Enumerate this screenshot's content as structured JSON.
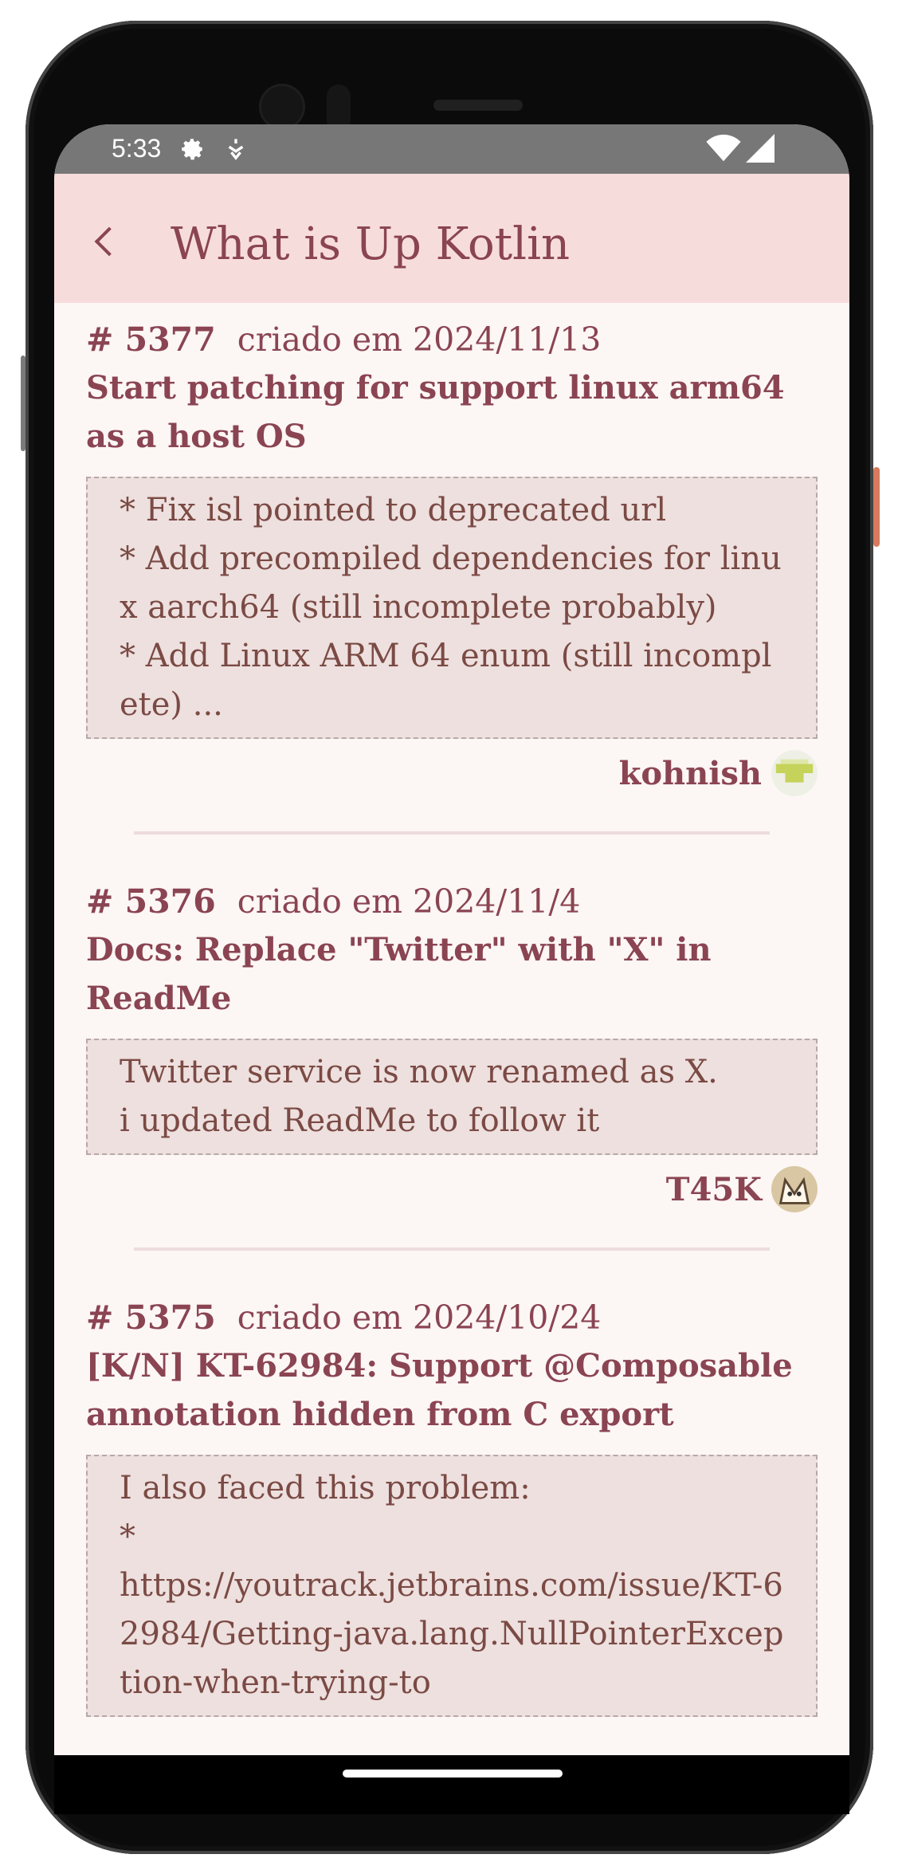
{
  "status_bar": {
    "time": "5:33"
  },
  "app_bar": {
    "title": "What is Up Kotlin"
  },
  "pull_requests": [
    {
      "number": "# 5377",
      "created": "criado em 2024/11/13",
      "title": "Start patching for support linux arm64 as a host OS",
      "body": "* Fix isl pointed to deprecated url\n* Add precompiled dependencies for linux aarch64 (still incomplete probably)\n* Add Linux ARM 64 enum (still incomplete) ...",
      "author": "kohnish"
    },
    {
      "number": "# 5376",
      "created": "criado em 2024/11/4",
      "title": "Docs: Replace \"Twitter\" with \"X\" in ReadMe",
      "body": "Twitter service is now renamed as X.\ni updated ReadMe to follow it",
      "author": "T45K"
    },
    {
      "number": "# 5375",
      "created": "criado em 2024/10/24",
      "title": "[K/N] KT-62984: Support @Composable annotation hidden from C export",
      "body": "I also faced this problem:\n*\nhttps://youtrack.jetbrains.com/issue/KT-62984/Getting-java.lang.NullPointerException-when-trying-to",
      "author": ""
    }
  ]
}
